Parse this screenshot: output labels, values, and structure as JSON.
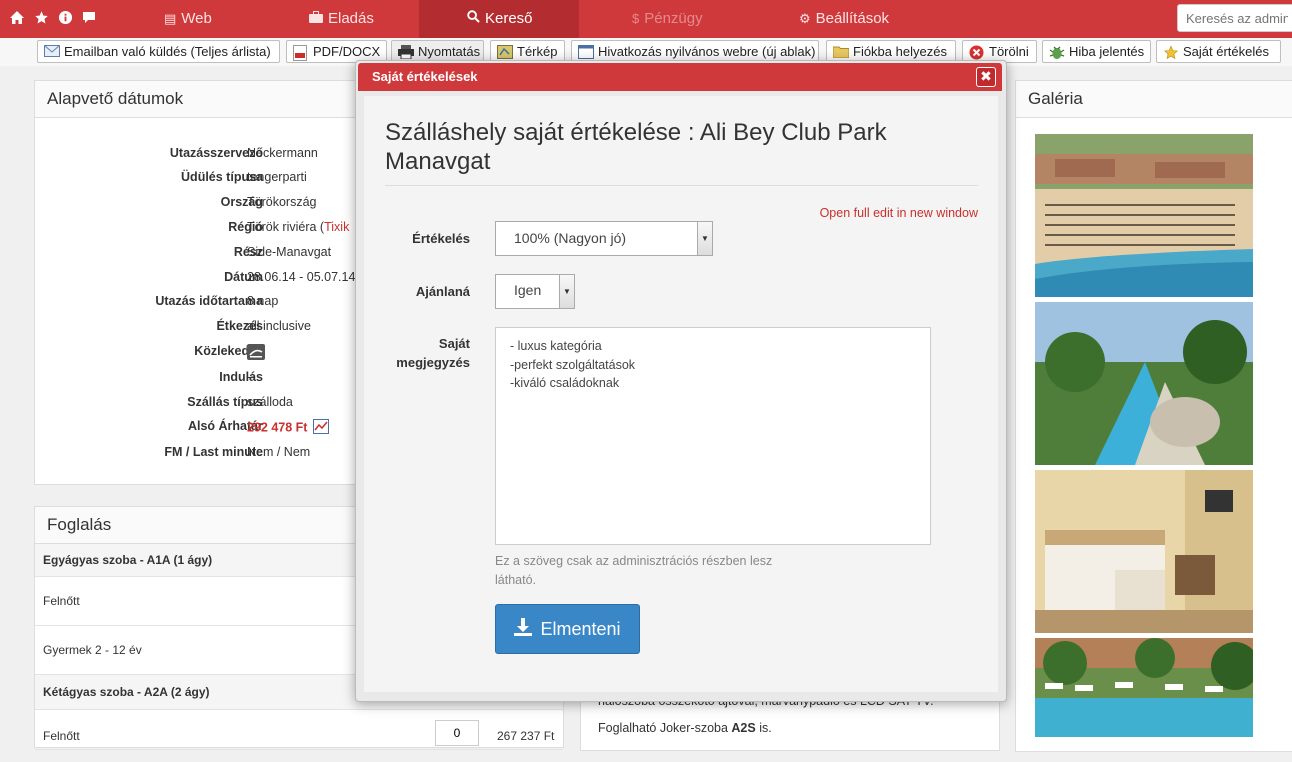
{
  "nav": {
    "items": [
      {
        "label": "Web",
        "icon": "file-icon"
      },
      {
        "label": "Eladás",
        "icon": "briefcase-icon"
      },
      {
        "label": "Kereső",
        "icon": "search-icon"
      },
      {
        "label": "Pénzügy",
        "icon": "dollar-icon"
      },
      {
        "label": "Beállítások",
        "icon": "gear-icon"
      }
    ],
    "search_placeholder": "Keresés az admin"
  },
  "toolbar": {
    "buttons": [
      "Emailban való küldés (Teljes árlista)",
      "PDF/DOCX",
      "Nyomtatás",
      "Térkép",
      "Hivatkozás nyilvános webre (új ablak)",
      "Fiókba helyezés",
      "Törölni",
      "Hiba jelentés",
      "Saját értékelés"
    ]
  },
  "basic": {
    "title": "Alapvető dátumok",
    "rows": [
      {
        "label": "Utazásszervező",
        "value": "Neckermann"
      },
      {
        "label": "Üdülés típusa",
        "value": "tengerparti"
      },
      {
        "label": "Ország",
        "value": "Törökország"
      },
      {
        "label": "Régió",
        "value": "Török riviéra (",
        "extra": "Tixik"
      },
      {
        "label": "Rész",
        "value": "Side-Manavgat"
      },
      {
        "label": "Dátum",
        "value": "28.06.14 - 05.07.14"
      },
      {
        "label": "Utazás időtartama",
        "value": "8 nap"
      },
      {
        "label": "Étkezés",
        "value": "all inclusive"
      },
      {
        "label": "Közlekedés",
        "value": ""
      },
      {
        "label": "Indulás",
        "value": "--"
      },
      {
        "label": "Szállás típus",
        "value": "szálloda"
      },
      {
        "label": "Alsó Árhatár",
        "value": "292 478 Ft"
      },
      {
        "label": "FM / Last minute",
        "value": "Nem / Nem"
      }
    ]
  },
  "booking": {
    "title": "Foglalás",
    "rows": [
      {
        "label": "Egyágyas szoba - A1A (1 ágy)"
      },
      {
        "label": "Felnőtt"
      },
      {
        "label": "Gyermek 2 - 12 év"
      },
      {
        "label": "Kétágyas szoba - A2A (2 ágy)"
      },
      {
        "label": "Felnőtt",
        "qty": "0",
        "price": "267 237 Ft"
      }
    ]
  },
  "gallery": {
    "title": "Galéria"
  },
  "bg_text": {
    "line1": "hálószoba összekötő ajtóval, márványpadló és LCD SAT-TV.",
    "line2_pre": "Foglalható Joker-szoba ",
    "line2_bold": "A2S",
    "line2_post": " is."
  },
  "modal": {
    "header": "Saját értékelések",
    "title": "Szálláshely saját értékelése : Ali Bey Club Park Manavgat",
    "open_link": "Open full edit in new window",
    "rating_label": "Értékelés",
    "rating_value": "100% (Nagyon jó)",
    "recommend_label": "Ajánlaná",
    "recommend_value": "Igen",
    "note_label": "Saját megjegyzés",
    "note_value": "- luxus kategória\n-perfekt szolgáltatások\n-kiváló családoknak",
    "help_text": "Ez a szöveg csak az adminisztrációs részben lesz látható.",
    "save_label": "Elmenteni"
  },
  "colors": {
    "brand": "#d0393c",
    "primary": "#3a87c8",
    "link": "#c9302c"
  }
}
